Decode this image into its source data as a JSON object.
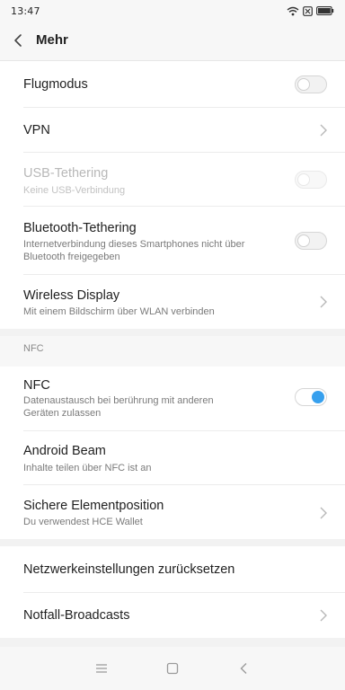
{
  "status": {
    "time": "13:47"
  },
  "header": {
    "title": "Mehr"
  },
  "items": {
    "flugmodus": {
      "label": "Flugmodus",
      "toggle": "off"
    },
    "vpn": {
      "label": "VPN"
    },
    "usb": {
      "label": "USB-Tethering",
      "sub": "Keine USB-Verbindung",
      "toggle": "off-disabled"
    },
    "bluetooth": {
      "label": "Bluetooth-Tethering",
      "sub": "Internetverbindung dieses Smartphones nicht über Bluetooth freigegeben",
      "toggle": "off"
    },
    "wireless": {
      "label": "Wireless Display",
      "sub": "Mit einem Bildschirm über WLAN verbinden"
    },
    "nfc_header": {
      "label": "NFC"
    },
    "nfc": {
      "label": "NFC",
      "sub": "Datenaustausch bei berührung mit anderen Geräten zulassen",
      "toggle": "on"
    },
    "beam": {
      "label": "Android Beam",
      "sub": "Inhalte teilen über NFC ist an"
    },
    "secure": {
      "label": "Sichere Elementposition",
      "sub": "Du verwendest HCE Wallet"
    },
    "reset": {
      "label": "Netzwerkeinstellungen zurücksetzen"
    },
    "broadcasts": {
      "label": "Notfall-Broadcasts"
    }
  },
  "colors": {
    "accent": "#37a0ee",
    "background": "#f7f7f7",
    "item": "#ffffff"
  },
  "icons": [
    "wifi-icon",
    "sim-icon",
    "battery-icon",
    "back-icon",
    "chevron-right-icon",
    "menu-icon",
    "home-icon",
    "back-nav-icon"
  ]
}
